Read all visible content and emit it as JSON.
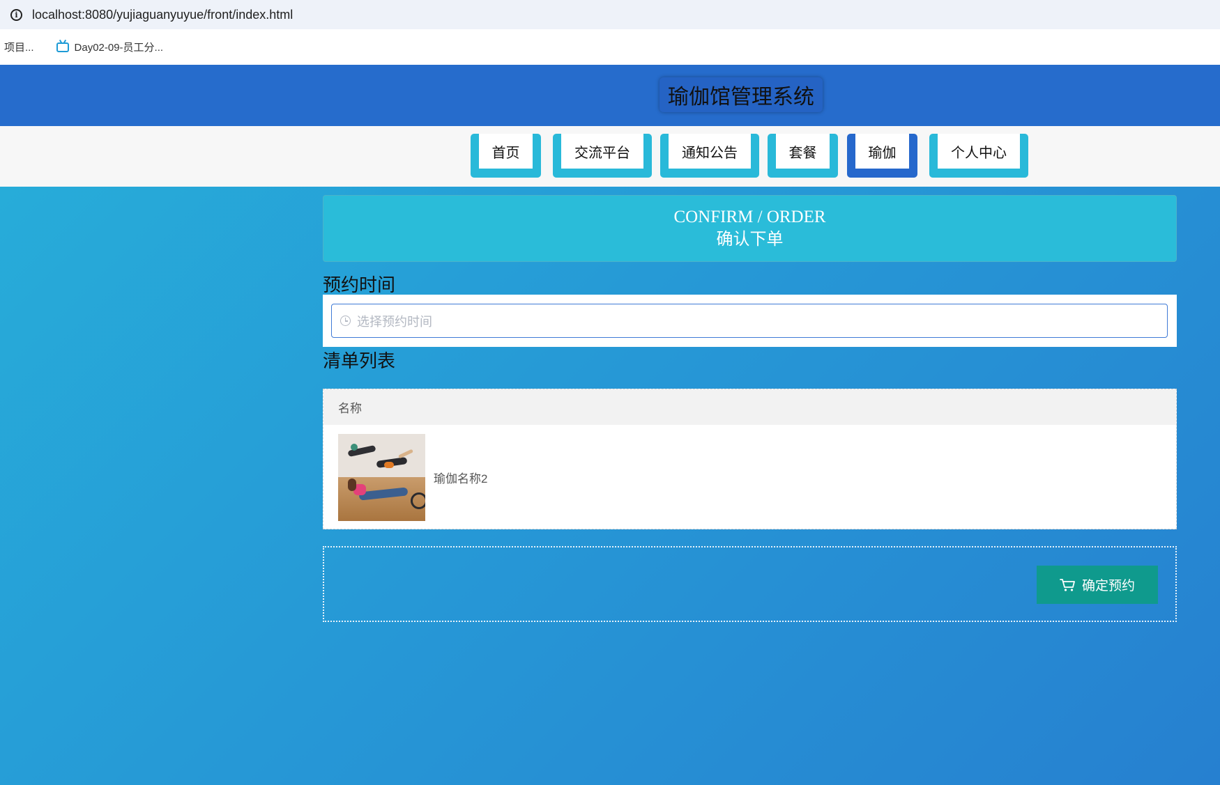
{
  "browser": {
    "url": "localhost:8080/yujiaguanyuyue/front/index.html",
    "bookmarks": [
      {
        "label": "项目..."
      },
      {
        "label": "Day02-09-员工分..."
      }
    ]
  },
  "header": {
    "title": "瑜伽馆管理系统"
  },
  "nav": {
    "items": [
      {
        "label": "首页"
      },
      {
        "label": "交流平台"
      },
      {
        "label": "通知公告"
      },
      {
        "label": "套餐"
      },
      {
        "label": "瑜伽",
        "active": true
      },
      {
        "label": "个人中心"
      }
    ]
  },
  "banner": {
    "en": "CONFIRM / ORDER",
    "cn": "确认下单"
  },
  "booking": {
    "label": "预约时间",
    "placeholder": "选择预约时间"
  },
  "list": {
    "label": "清单列表",
    "header": "名称",
    "items": [
      {
        "name": "瑜伽名称2"
      }
    ]
  },
  "actions": {
    "confirm_label": "确定预约"
  },
  "colors": {
    "header_bg": "#266ccc",
    "nav_accent": "#29b9d9",
    "nav_active": "#2668cc",
    "confirm_button": "#0f9a8d"
  }
}
